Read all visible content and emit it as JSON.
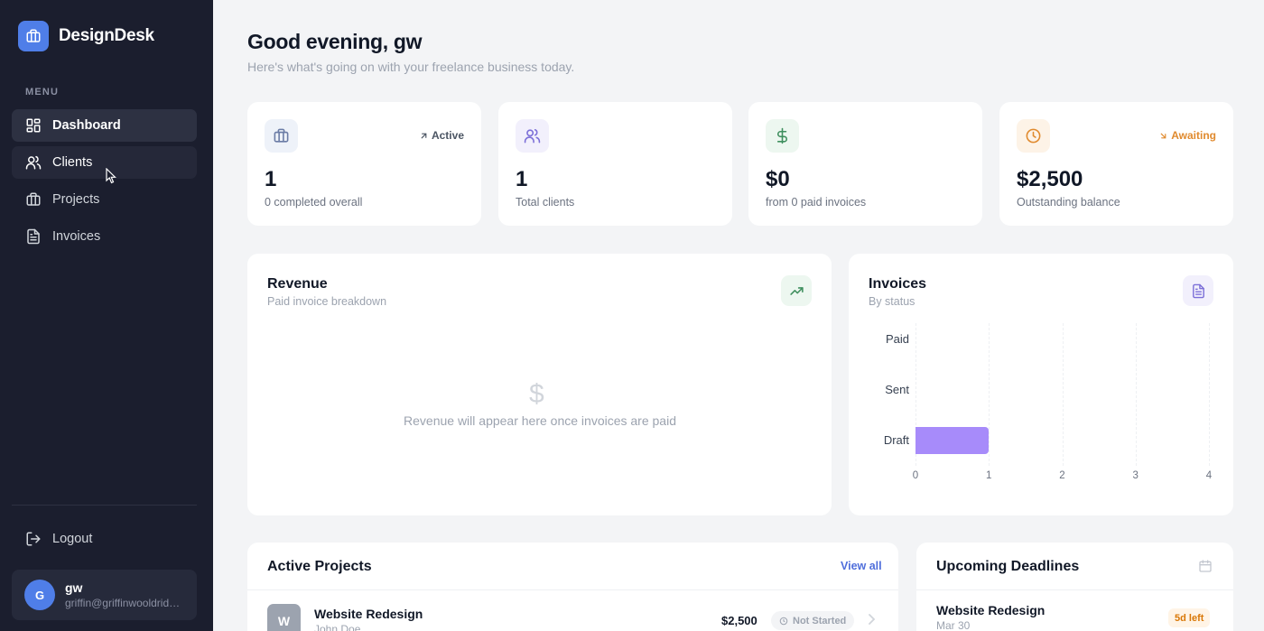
{
  "app": {
    "name": "DesignDesk",
    "logo_icon": "briefcase-icon"
  },
  "sidebar": {
    "menu_label": "MENU",
    "items": [
      {
        "label": "Dashboard",
        "icon": "dashboard-grid-icon",
        "state": "active"
      },
      {
        "label": "Clients",
        "icon": "users-icon",
        "state": "hover"
      },
      {
        "label": "Projects",
        "icon": "briefcase-icon",
        "state": "default"
      },
      {
        "label": "Invoices",
        "icon": "document-icon",
        "state": "default"
      }
    ],
    "logout_label": "Logout",
    "user": {
      "initial": "G",
      "name": "gw",
      "email": "griffin@griffinwooldridge.com"
    }
  },
  "header": {
    "greeting": "Good evening, gw",
    "subtitle": "Here's what's going on with your freelance business today."
  },
  "stats": [
    {
      "icon": "briefcase-icon",
      "badge": "Active",
      "badge_icon": "arrow-up-right-icon",
      "value": "1",
      "caption": "0 completed overall",
      "accent": "#6b7ca6"
    },
    {
      "icon": "users-icon",
      "badge": "",
      "value": "1",
      "caption": "Total clients",
      "accent": "#7c6fd8"
    },
    {
      "icon": "dollar-icon",
      "badge": "",
      "value": "$0",
      "caption": "from 0 paid invoices",
      "accent": "#3f8f5e"
    },
    {
      "icon": "clock-icon",
      "badge": "Awaiting",
      "badge_icon": "arrow-down-right-icon",
      "value": "$2,500",
      "caption": "Outstanding balance",
      "accent": "#e08a2e"
    }
  ],
  "revenue": {
    "title": "Revenue",
    "subtitle": "Paid invoice breakdown",
    "empty_message": "Revenue will appear here once invoices are paid",
    "empty_icon": "$"
  },
  "invoices": {
    "title": "Invoices",
    "subtitle": "By status",
    "chart_data": {
      "type": "bar",
      "orientation": "horizontal",
      "categories": [
        "Paid",
        "Sent",
        "Draft"
      ],
      "values": [
        0,
        0,
        1
      ],
      "xlim": [
        0,
        4
      ],
      "x_ticks": [
        "0",
        "1",
        "2",
        "3",
        "4"
      ],
      "bar_color": "#a78bfa",
      "grid": true
    }
  },
  "active_projects": {
    "title": "Active Projects",
    "view_all": "View all",
    "rows": [
      {
        "initial": "W",
        "name": "Website Redesign",
        "client": "John Doe",
        "amount": "$2,500",
        "status": "Not Started"
      }
    ]
  },
  "deadlines": {
    "title": "Upcoming Deadlines",
    "rows": [
      {
        "name": "Website Redesign",
        "date": "Mar 30",
        "badge": "5d left"
      }
    ]
  },
  "colors": {
    "sidebar_bg": "#1b1e2e",
    "brand": "#4f7ee8",
    "page_bg": "#f3f4f6"
  }
}
